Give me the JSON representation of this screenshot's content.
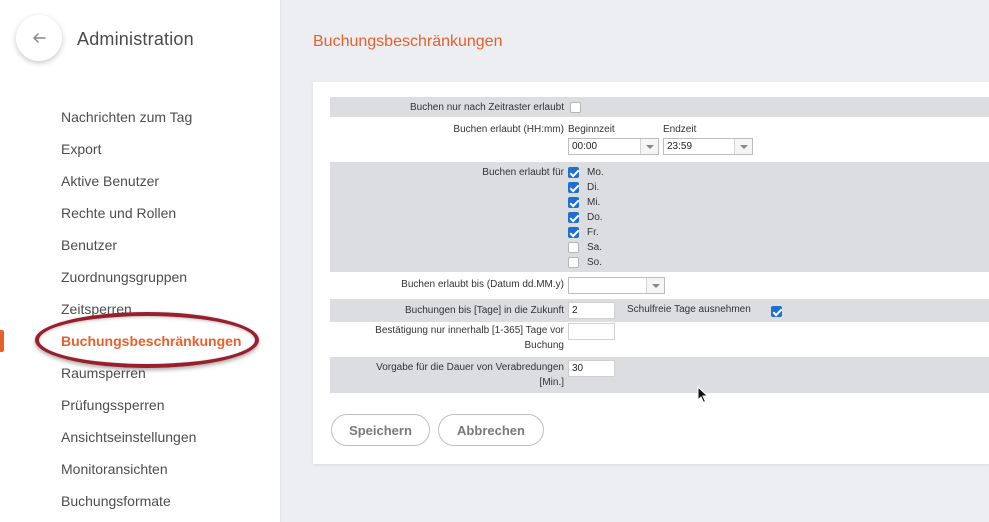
{
  "sidebar": {
    "title": "Administration",
    "items": [
      {
        "label": "Nachrichten zum Tag"
      },
      {
        "label": "Export"
      },
      {
        "label": "Aktive Benutzer"
      },
      {
        "label": "Rechte und Rollen"
      },
      {
        "label": "Benutzer"
      },
      {
        "label": "Zuordnungsgruppen"
      },
      {
        "label": "Zeitsperren"
      },
      {
        "label": "Buchungsbeschränkungen"
      },
      {
        "label": "Raumsperren"
      },
      {
        "label": "Prüfungssperren"
      },
      {
        "label": "Ansichtseinstellungen"
      },
      {
        "label": "Monitoransichten"
      },
      {
        "label": "Buchungsformate"
      }
    ]
  },
  "page": {
    "title": "Buchungsbeschränkungen"
  },
  "form": {
    "zeitraster_label": "Buchen nur nach Zeitraster erlaubt",
    "zeitraster_checked": false,
    "erlaubt_label": "Buchen erlaubt (HH:mm)",
    "beginn_label": "Beginnzeit",
    "beginn_value": "00:00",
    "ende_label": "Endzeit",
    "ende_value": "23:59",
    "tage_label": "Buchen erlaubt für",
    "days": [
      {
        "label": "Mo.",
        "checked": true
      },
      {
        "label": "Di.",
        "checked": true
      },
      {
        "label": "Mi.",
        "checked": true
      },
      {
        "label": "Do.",
        "checked": true
      },
      {
        "label": "Fr.",
        "checked": true
      },
      {
        "label": "Sa.",
        "checked": false
      },
      {
        "label": "So.",
        "checked": false
      }
    ],
    "bis_datum_label": "Buchen erlaubt bis (Datum dd.MM.y)",
    "bis_datum_value": "",
    "zukunft_label": "Buchungen bis [Tage] in die Zukunft",
    "zukunft_value": "2",
    "schulfrei_label": "Schulfreie Tage ausnehmen",
    "schulfrei_checked": true,
    "bestaetigung_label_1": "Bestätigung nur innerhalb [1-365] Tage vor",
    "bestaetigung_label_2": "Buchung",
    "bestaetigung_value": "",
    "dauer_label_1": "Vorgabe für die Dauer von Verabredungen",
    "dauer_label_2": "[Min.]",
    "dauer_value": "30"
  },
  "buttons": {
    "save": "Speichern",
    "cancel": "Abbrechen"
  },
  "icons": {
    "back": "arrow-left-icon",
    "cursor": "mouse-pointer-icon"
  },
  "colors": {
    "accent": "#e8602c",
    "checkbox": "#1f6fd1",
    "highlight": "#98202c"
  }
}
